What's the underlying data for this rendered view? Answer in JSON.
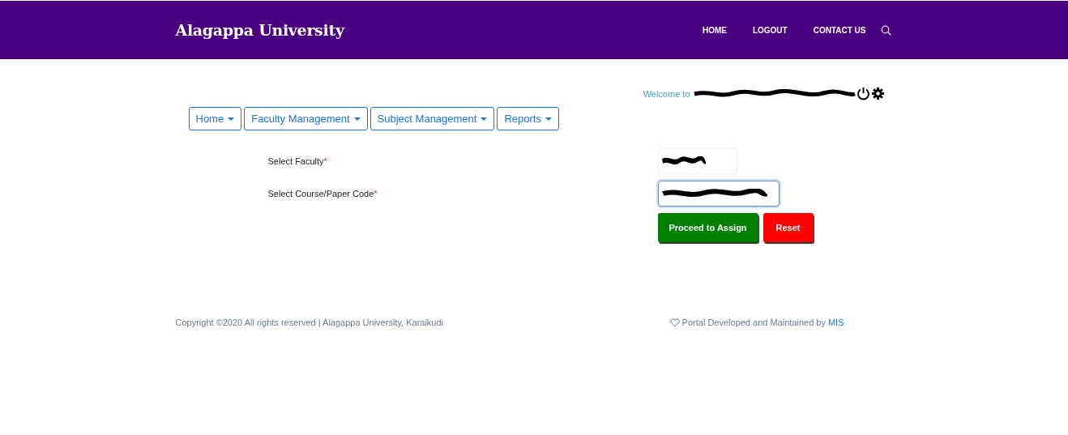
{
  "header": {
    "title": "Alagappa University",
    "nav": [
      {
        "label": "HOME"
      },
      {
        "label": "LOGOUT"
      },
      {
        "label": "CONTACT US"
      }
    ]
  },
  "welcome": {
    "text": "Welcome to"
  },
  "menus": [
    {
      "label": "Home"
    },
    {
      "label": "Faculty Management"
    },
    {
      "label": "Subject Management"
    },
    {
      "label": "Reports"
    }
  ],
  "form": {
    "fields": [
      {
        "label": "Select Faculty",
        "required_mark": "*",
        "focused": false
      },
      {
        "label": "Select Course/Paper Code",
        "required_mark": "*",
        "focused": true
      }
    ],
    "buttons": [
      {
        "label": "Proceed to Assign",
        "kind": "primary"
      },
      {
        "label": "Reset",
        "kind": "danger"
      }
    ]
  },
  "footer": {
    "copyright": "Copyright ©2020 All rights reserved | Alagappa University, Karaikudi",
    "credit": "Portal Developed and Maintained by",
    "credit_link": "MIS"
  }
}
